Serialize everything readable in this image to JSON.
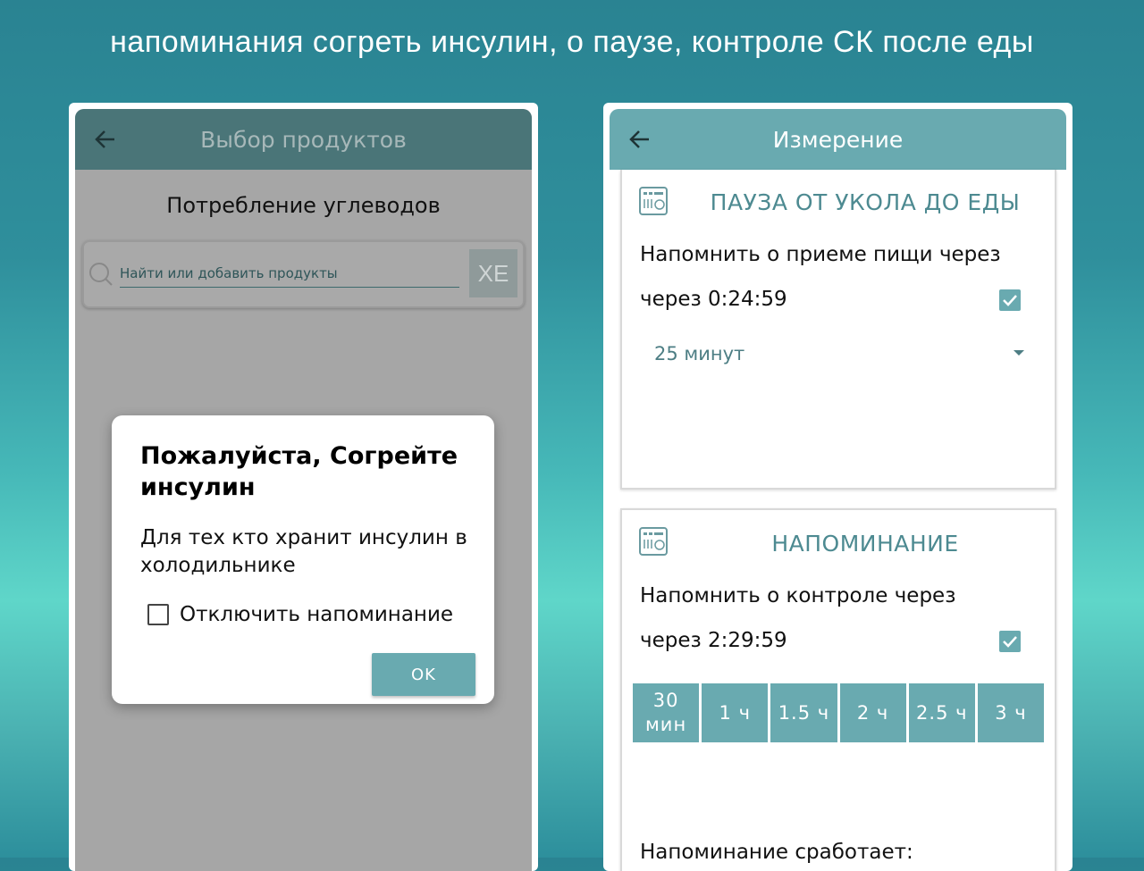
{
  "headline": "напоминания согреть инсулин, о паузе, контроле СК после еды",
  "left_screen": {
    "appbar_title": "Выбор продуктов",
    "subtitle": "Потребление углеводов",
    "search": {
      "placeholder": "Найти или добавить продукты",
      "button_label": "ХЕ"
    },
    "dialog": {
      "title": "Пожалуйста, Согрейте инсулин",
      "message": "Для тех кто хранит инсулин в холодильнике",
      "checkbox_label": "Отключить напоминание",
      "checkbox_checked": false,
      "ok_label": "OK"
    }
  },
  "right_screen": {
    "appbar_title": "Измерение",
    "pause_card": {
      "title": "ПАУЗА ОТ УКОЛА ДО ЕДЫ",
      "line1": "Напомнить о приеме пищи через",
      "line2": "через 0:24:59",
      "checked": true,
      "dropdown_value": "25 минут"
    },
    "reminder_card": {
      "title": "НАПОМИНАНИЕ",
      "line1": "Напомнить о контроле через",
      "line2": "через 2:29:59",
      "checked": true,
      "time_options": [
        "30 мин",
        "1 ч",
        "1.5 ч",
        "2 ч",
        "2.5 ч",
        "3 ч"
      ],
      "footer": "Напоминание сработает:"
    }
  },
  "colors": {
    "accent": "#69aab0",
    "appbar_dimmed": "#4a7578",
    "title_teal": "#4d8a91"
  },
  "icons": [
    "back-arrow-icon",
    "search-icon",
    "calculator-icon",
    "check-icon",
    "dropdown-arrow-icon"
  ]
}
